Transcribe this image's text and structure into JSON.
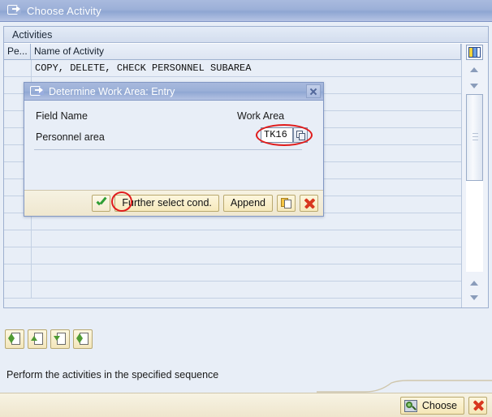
{
  "window": {
    "title": "Choose Activity",
    "icon": "choose-activity-icon"
  },
  "grid": {
    "caption": "Activities",
    "columns": [
      "Pe...",
      "Name of Activity"
    ],
    "rows": [
      {
        "pe": "",
        "name": "COPY, DELETE, CHECK PERSONNEL SUBAREA"
      },
      {
        "pe": "",
        "name": ""
      },
      {
        "pe": "",
        "name": ""
      },
      {
        "pe": "",
        "name": ""
      },
      {
        "pe": "",
        "name": ""
      },
      {
        "pe": "",
        "name": ""
      },
      {
        "pe": "",
        "name": ""
      },
      {
        "pe": "",
        "name": ""
      },
      {
        "pe": "",
        "name": ""
      },
      {
        "pe": "",
        "name": ""
      },
      {
        "pe": "",
        "name": ""
      },
      {
        "pe": "",
        "name": ""
      },
      {
        "pe": "",
        "name": ""
      },
      {
        "pe": "",
        "name": ""
      }
    ],
    "scrollbar": {
      "column_config_icon": "column-settings-icon",
      "up_icon": "scroll-up-icon",
      "down_icon": "scroll-down-icon"
    }
  },
  "dialog": {
    "title": "Determine Work Area: Entry",
    "icon": "dialog-window-icon",
    "close_label": "✕",
    "headers": {
      "field_name": "Field Name",
      "work_area": "Work Area"
    },
    "field": {
      "label": "Personnel area",
      "value": "TK16",
      "placeholder": "",
      "f4_icon": "value-help-icon"
    },
    "buttons": {
      "ok": "",
      "ok_icon": "green-check-icon",
      "further_select": "Further select cond.",
      "append": "Append",
      "copy_icon": "copy-icon",
      "cancel_icon": "red-x-icon"
    },
    "annotation_color": "#e01b1b"
  },
  "navigation": {
    "buttons": [
      {
        "name": "first-entry-button",
        "icon": "doc-up-down-icon"
      },
      {
        "name": "previous-entry-button",
        "icon": "doc-up-icon"
      },
      {
        "name": "next-entry-button",
        "icon": "doc-down-icon"
      },
      {
        "name": "last-entry-button",
        "icon": "doc-up-down-icon"
      }
    ]
  },
  "status": {
    "text": "Perform the activities in the specified sequence"
  },
  "bottom_bar": {
    "choose_label": "Choose",
    "choose_icon": "magnifier-icon",
    "cancel_icon": "red-x-icon"
  }
}
